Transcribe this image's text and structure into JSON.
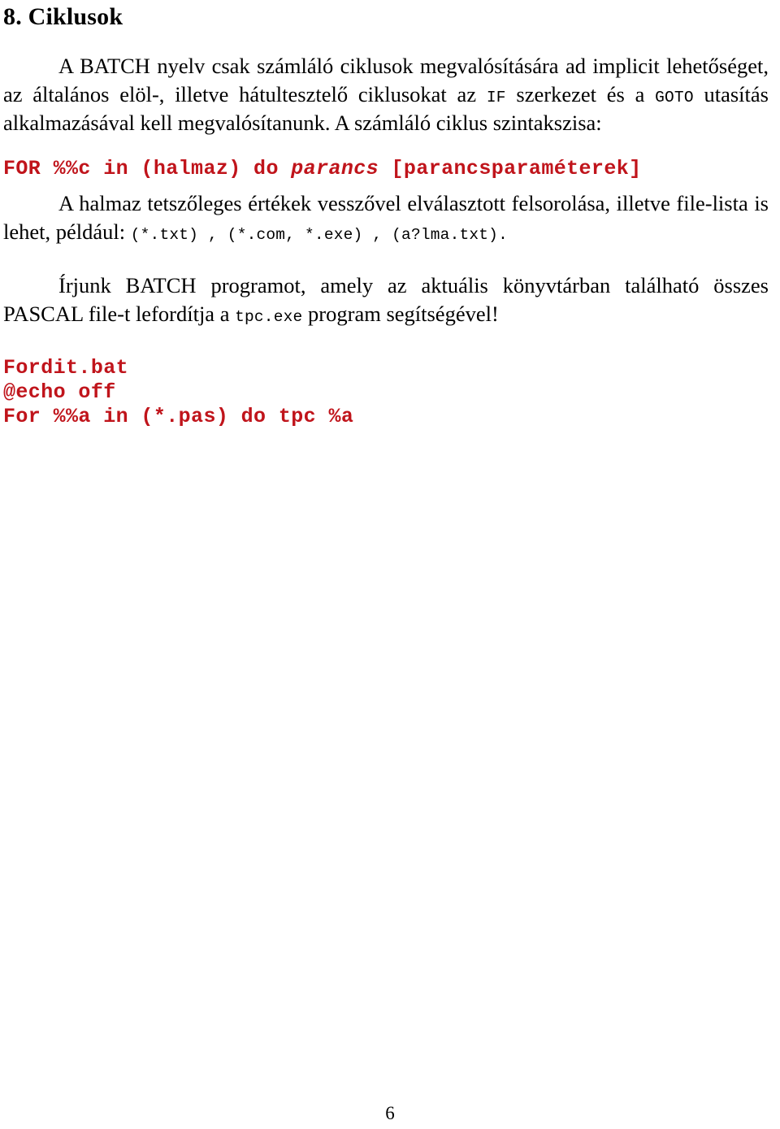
{
  "document": {
    "language": "hu",
    "page_number": "6",
    "text_color": "#000000",
    "code_color": "#C0141B",
    "background_color": "#FFFFFF"
  },
  "heading": {
    "number": "8.",
    "title": "Ciklusok",
    "full": "8. Ciklusok"
  },
  "paragraph_1": {
    "part_1": "A BATCH nyelv csak számláló ciklusok megvalósítására ad implicit lehetőséget, az általános elöl-, illetve hátultesztelő ciklusokat az ",
    "keyword_if": "IF",
    "part_2": " szerkezet és a ",
    "keyword_goto": "GOTO",
    "part_3": " utasítás alkalmazásával kell megvalósítanunk. A számláló ciklus szintakszisa:"
  },
  "syntax_line": {
    "before_italic": "FOR %%c in (halmaz) do ",
    "italic": "parancs",
    "after_italic": " [parancsparaméterek]",
    "full": "FOR %%c in (halmaz) do parancs [parancsparaméterek]"
  },
  "paragraph_2": {
    "part_1": "A halmaz tetszőleges értékek vesszővel elválasztott felsorolása, illetve file-lista is lehet, például: ",
    "example_1": "(*.txt)",
    "separator_1": " , ",
    "example_2": "(*.com, *.exe)",
    "separator_2": " , ",
    "example_3": "(a?lma.txt)",
    "part_end": "."
  },
  "paragraph_3": {
    "part_1": "Írjunk BATCH programot, amely az aktuális könyvtárban található összes PASCAL file-t lefordítja a ",
    "keyword_tpc": "tpc.exe",
    "part_2": " program segítségével!"
  },
  "code_block": {
    "line_1": "Fordit.bat",
    "line_2": "@echo off",
    "line_3": "For %%a in (*.pas) do tpc %a"
  }
}
